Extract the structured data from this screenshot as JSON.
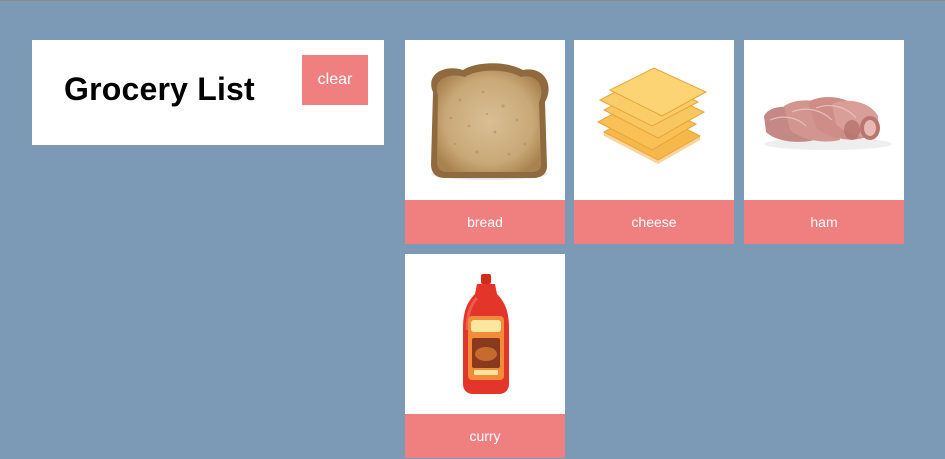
{
  "header": {
    "title": "Grocery List",
    "clear_label": "clear"
  },
  "items": [
    {
      "label": "bread",
      "icon": "bread-slice-image"
    },
    {
      "label": "cheese",
      "icon": "cheese-slices-image"
    },
    {
      "label": "ham",
      "icon": "ham-rolls-image"
    },
    {
      "label": "curry",
      "icon": "curry-bottle-image"
    }
  ],
  "colors": {
    "background": "#7c99b6",
    "accent": "#f08080",
    "card": "#ffffff"
  }
}
